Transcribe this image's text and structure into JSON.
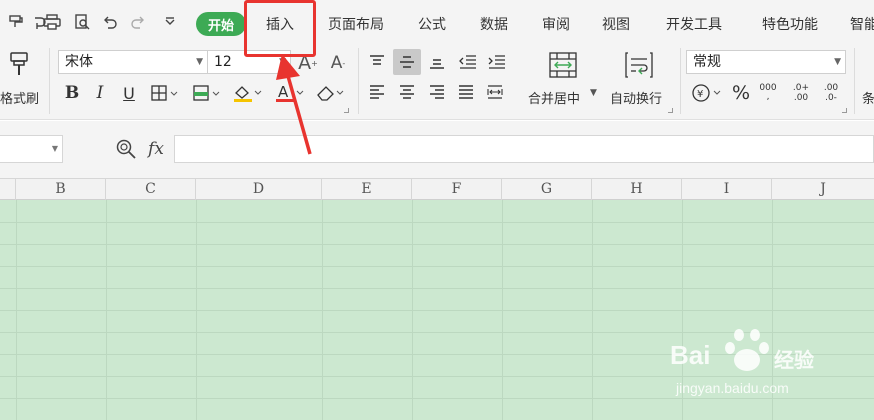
{
  "quick_access": {
    "icons": [
      "format-painter-icon",
      "redo-arrow-icon",
      "print-icon",
      "print-preview-icon",
      "undo-icon",
      "redo-icon",
      "more-dropdown-icon"
    ]
  },
  "tabs": [
    {
      "label": "开始",
      "active": true
    },
    {
      "label": "插入",
      "active": false
    },
    {
      "label": "页面布局",
      "active": false
    },
    {
      "label": "公式",
      "active": false
    },
    {
      "label": "数据",
      "active": false
    },
    {
      "label": "审阅",
      "active": false
    },
    {
      "label": "视图",
      "active": false
    },
    {
      "label": "开发工具",
      "active": false
    },
    {
      "label": "特色功能",
      "active": false
    },
    {
      "label": "智能",
      "active": false
    }
  ],
  "ribbon": {
    "format_painter_label": "格式刷",
    "font_name": "宋体",
    "font_size": "12",
    "merge_label": "合并居中",
    "wrap_label": "自动换行",
    "number_format": "常规",
    "condition_label": "条"
  },
  "formula_bar": {
    "fx_label": "fx",
    "value": ""
  },
  "columns": [
    "B",
    "C",
    "D",
    "E",
    "F",
    "G",
    "H",
    "I",
    "J"
  ],
  "watermark": {
    "brand": "Bai",
    "brand_cn": "经验",
    "url": "jingyan.baidu.com"
  },
  "colors": {
    "accent_green": "#3daa55",
    "sheet_fill": "#cce8d0",
    "annotation_red": "#e8342f"
  }
}
